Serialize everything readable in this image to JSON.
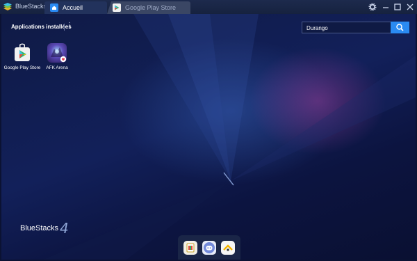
{
  "titlebar": {
    "app_title": "BlueStacks",
    "tabs": [
      {
        "label": "Accueil",
        "icon": "home-icon",
        "active": true
      },
      {
        "label": "Google Play Store",
        "icon": "play-store-icon",
        "active": false
      }
    ],
    "window_controls": [
      "settings-icon",
      "minimize-icon",
      "maximize-icon",
      "close-icon"
    ]
  },
  "home": {
    "section_title": "Applications installées",
    "search": {
      "value": "Durango",
      "icon": "search-icon"
    },
    "apps": [
      {
        "label": "Google Play Store",
        "icon": "play-store-icon"
      },
      {
        "label": "AFK Arena",
        "icon": "afk-arena-icon"
      }
    ],
    "brand": "BlueStacks",
    "brand_version": "4",
    "dock": [
      "app-center-icon",
      "discord-icon",
      "helper-icon"
    ]
  },
  "colors": {
    "accent": "#2a8af2",
    "titlebar": "#1d2a4d",
    "background": "#0f1a45"
  }
}
